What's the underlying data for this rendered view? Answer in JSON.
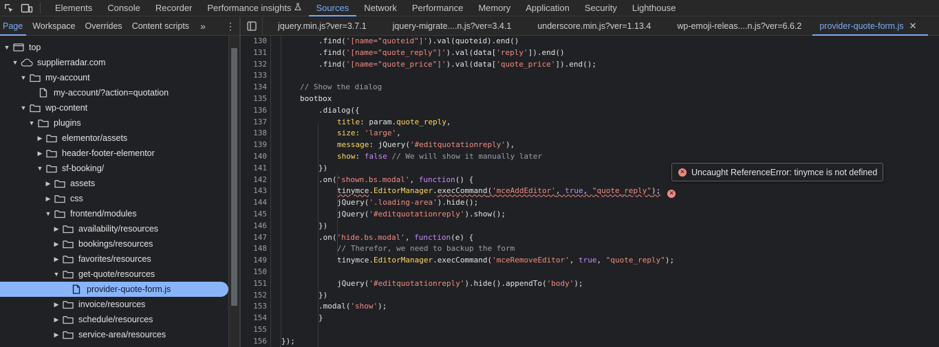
{
  "toolbar": {
    "inspect_icon": "inspect-element-icon",
    "device_icon": "device-toolbar-icon",
    "tabs": [
      {
        "label": "Elements"
      },
      {
        "label": "Console"
      },
      {
        "label": "Recorder"
      },
      {
        "label": "Performance insights"
      },
      {
        "label": "Sources"
      },
      {
        "label": "Network"
      },
      {
        "label": "Performance"
      },
      {
        "label": "Memory"
      },
      {
        "label": "Application"
      },
      {
        "label": "Security"
      },
      {
        "label": "Lighthouse"
      }
    ],
    "active_tab": "Sources"
  },
  "navigator": {
    "tabs": [
      {
        "label": "Page"
      },
      {
        "label": "Workspace"
      },
      {
        "label": "Overrides"
      },
      {
        "label": "Content scripts"
      }
    ],
    "active_tab": "Page",
    "tree": [
      {
        "label": "top",
        "depth": 0,
        "type": "frame",
        "expanded": true
      },
      {
        "label": "supplierradar.com",
        "depth": 1,
        "type": "domain",
        "expanded": true
      },
      {
        "label": "my-account",
        "depth": 2,
        "type": "folder",
        "expanded": true
      },
      {
        "label": "my-account/?action=quotation",
        "depth": 3,
        "type": "file"
      },
      {
        "label": "wp-content",
        "depth": 2,
        "type": "folder",
        "expanded": true
      },
      {
        "label": "plugins",
        "depth": 3,
        "type": "folder",
        "expanded": true
      },
      {
        "label": "elementor/assets",
        "depth": 4,
        "type": "folder",
        "expanded": false
      },
      {
        "label": "header-footer-elementor",
        "depth": 4,
        "type": "folder",
        "expanded": false
      },
      {
        "label": "sf-booking/",
        "depth": 4,
        "type": "folder",
        "expanded": true
      },
      {
        "label": "assets",
        "depth": 5,
        "type": "folder",
        "expanded": false
      },
      {
        "label": "css",
        "depth": 5,
        "type": "folder",
        "expanded": false
      },
      {
        "label": "frontend/modules",
        "depth": 5,
        "type": "folder",
        "expanded": true
      },
      {
        "label": "availability/resources",
        "depth": 6,
        "type": "folder",
        "expanded": false
      },
      {
        "label": "bookings/resources",
        "depth": 6,
        "type": "folder",
        "expanded": false
      },
      {
        "label": "favorites/resources",
        "depth": 6,
        "type": "folder",
        "expanded": false
      },
      {
        "label": "get-quote/resources",
        "depth": 6,
        "type": "folder",
        "expanded": true
      },
      {
        "label": "provider-quote-form.js",
        "depth": 7,
        "type": "file",
        "selected": true
      },
      {
        "label": "invoice/resources",
        "depth": 6,
        "type": "folder",
        "expanded": false
      },
      {
        "label": "schedule/resources",
        "depth": 6,
        "type": "folder",
        "expanded": false
      },
      {
        "label": "service-area/resources",
        "depth": 6,
        "type": "folder",
        "expanded": false
      }
    ]
  },
  "editor": {
    "tabs": [
      {
        "label": "jquery.min.js?ver=3.7.1"
      },
      {
        "label": "jquery-migrate....n.js?ver=3.4.1"
      },
      {
        "label": "underscore.min.js?ver=1.13.4"
      },
      {
        "label": "wp-emoji-releas....n.js?ver=6.6.2"
      },
      {
        "label": "provider-quote-form.js",
        "active": true
      }
    ],
    "error_tooltip": "Uncaught ReferenceError: tinymce is not defined",
    "error_line": 143,
    "lines": [
      {
        "n": 130,
        "indent": 5,
        "tokens": [
          [
            ".find(",
            ""
          ],
          [
            "'[name=\"quoteid\"]'",
            "str"
          ],
          [
            ").val(quoteid).end()",
            ""
          ]
        ]
      },
      {
        "n": 131,
        "indent": 5,
        "tokens": [
          [
            ".find(",
            ""
          ],
          [
            "'[name=\"quote_reply\"]'",
            "str"
          ],
          [
            ").val(data[",
            ""
          ],
          [
            "'reply'",
            "str"
          ],
          [
            "]).end()",
            ""
          ]
        ]
      },
      {
        "n": 132,
        "indent": 5,
        "tokens": [
          [
            ".find(",
            ""
          ],
          [
            "'[name=\"quote_price\"]'",
            "str"
          ],
          [
            ").val(data[",
            ""
          ],
          [
            "'quote_price'",
            "str"
          ],
          [
            "]).end();",
            ""
          ]
        ]
      },
      {
        "n": 133,
        "indent": 0,
        "tokens": []
      },
      {
        "n": 134,
        "indent": 4,
        "tokens": [
          [
            "// Show the dialog",
            "cmt"
          ]
        ]
      },
      {
        "n": 135,
        "indent": 4,
        "tokens": [
          [
            "bootbox",
            ""
          ]
        ]
      },
      {
        "n": 136,
        "indent": 5,
        "tokens": [
          [
            ".dialog({",
            ""
          ]
        ]
      },
      {
        "n": 137,
        "indent": 6,
        "tokens": [
          [
            "title",
            "key"
          ],
          [
            ": param.",
            ""
          ],
          [
            "quote_reply",
            "prop"
          ],
          [
            ",",
            ""
          ]
        ]
      },
      {
        "n": 138,
        "indent": 6,
        "tokens": [
          [
            "size",
            "key"
          ],
          [
            ": ",
            ""
          ],
          [
            "'large'",
            "str"
          ],
          [
            ",",
            ""
          ]
        ]
      },
      {
        "n": 139,
        "indent": 6,
        "tokens": [
          [
            "message",
            "key"
          ],
          [
            ": jQuery(",
            ""
          ],
          [
            "'#editquotationreply'",
            "str"
          ],
          [
            "),",
            ""
          ]
        ]
      },
      {
        "n": 140,
        "indent": 6,
        "tokens": [
          [
            "show",
            "key"
          ],
          [
            ": ",
            ""
          ],
          [
            "false",
            "lit"
          ],
          [
            " ",
            ""
          ],
          [
            "// We will show it manually later",
            "cmt"
          ]
        ]
      },
      {
        "n": 141,
        "indent": 5,
        "tokens": [
          [
            "})",
            ""
          ]
        ]
      },
      {
        "n": 142,
        "indent": 5,
        "tokens": [
          [
            ".on(",
            ""
          ],
          [
            "'shown.bs.modal'",
            "str"
          ],
          [
            ", ",
            ""
          ],
          [
            "function",
            "kw"
          ],
          [
            "() {",
            ""
          ]
        ]
      },
      {
        "n": 143,
        "indent": 6,
        "tokens": [
          [
            "tinymce",
            "sq"
          ],
          [
            ".",
            ""
          ],
          [
            "EditorManager",
            "prop"
          ],
          [
            ".",
            ""
          ],
          [
            "execCommand",
            "sq"
          ],
          [
            "(",
            "sq"
          ],
          [
            "'mceAddEditor'",
            "sqstr"
          ],
          [
            ", ",
            "sq"
          ],
          [
            "true",
            "sqlit"
          ],
          [
            ", ",
            "sq"
          ],
          [
            "\"quote_reply\"",
            "sqstr"
          ],
          [
            ");",
            "sq"
          ]
        ]
      },
      {
        "n": 144,
        "indent": 6,
        "tokens": [
          [
            "jQuery(",
            ""
          ],
          [
            "'.loading-area'",
            "str"
          ],
          [
            ").hide();",
            ""
          ]
        ]
      },
      {
        "n": 145,
        "indent": 6,
        "tokens": [
          [
            "jQuery(",
            ""
          ],
          [
            "'#editquotationreply'",
            "str"
          ],
          [
            ").show();",
            ""
          ]
        ]
      },
      {
        "n": 146,
        "indent": 5,
        "tokens": [
          [
            "})",
            ""
          ]
        ]
      },
      {
        "n": 147,
        "indent": 5,
        "tokens": [
          [
            ".on(",
            ""
          ],
          [
            "'hide.bs.modal'",
            "str"
          ],
          [
            ", ",
            ""
          ],
          [
            "function",
            "kw"
          ],
          [
            "(e) {",
            ""
          ]
        ]
      },
      {
        "n": 148,
        "indent": 6,
        "tokens": [
          [
            "// Therefor, we need to backup the form",
            "cmt"
          ]
        ]
      },
      {
        "n": 149,
        "indent": 6,
        "tokens": [
          [
            "tinymce.",
            ""
          ],
          [
            "EditorManager",
            "prop"
          ],
          [
            ".execCommand(",
            ""
          ],
          [
            "'mceRemoveEditor'",
            "str"
          ],
          [
            ", ",
            ""
          ],
          [
            "true",
            "lit"
          ],
          [
            ", ",
            ""
          ],
          [
            "\"quote_reply\"",
            "str"
          ],
          [
            ");",
            ""
          ]
        ]
      },
      {
        "n": 150,
        "indent": 0,
        "tokens": []
      },
      {
        "n": 151,
        "indent": 6,
        "tokens": [
          [
            "jQuery(",
            ""
          ],
          [
            "'#editquotationreply'",
            "str"
          ],
          [
            ").hide().appendTo(",
            ""
          ],
          [
            "'body'",
            "str"
          ],
          [
            ");",
            ""
          ]
        ]
      },
      {
        "n": 152,
        "indent": 5,
        "tokens": [
          [
            "})",
            ""
          ]
        ]
      },
      {
        "n": 153,
        "indent": 5,
        "tokens": [
          [
            ".modal(",
            ""
          ],
          [
            "'show'",
            "str"
          ],
          [
            ");",
            ""
          ]
        ]
      },
      {
        "n": 154,
        "indent": 5,
        "tokens": [
          [
            "}",
            ""
          ]
        ]
      },
      {
        "n": 155,
        "indent": 0,
        "tokens": []
      },
      {
        "n": 156,
        "indent": 3,
        "tokens": [
          [
            "});",
            ""
          ]
        ]
      }
    ]
  },
  "colors": {
    "accent": "#7cacf8",
    "selection": "#8ab4f8",
    "error": "#f28b82",
    "string": "#f28b82",
    "keyword": "#c58af9",
    "comment": "#9aa0a6",
    "property": "#fdd663"
  }
}
